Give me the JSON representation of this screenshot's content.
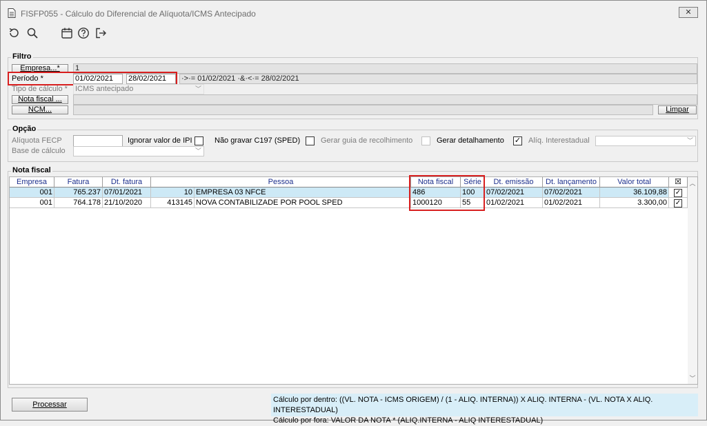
{
  "window": {
    "title": "FISFP055 - Cálculo do Diferencial de Alíquota/ICMS Antecipado",
    "close_label": "✕"
  },
  "toolbar": {
    "icons": [
      "refresh-icon",
      "search-icon",
      "calendar-icon",
      "help-icon",
      "exit-icon"
    ]
  },
  "filtro": {
    "legend": "Filtro",
    "empresa_button": "Empresa...*",
    "empresa_value": "1",
    "periodo_label": "Período *",
    "periodo_inicio": "01/02/2021",
    "periodo_fim": "28/02/2021",
    "periodo_expr": "·>·= 01/02/2021 ·&·<·= 28/02/2021",
    "tipo_calculo_label": "Tipo de cálculo *",
    "tipo_calculo_value": "ICMS antecipado",
    "nota_fiscal_button": "Nota fiscal ...",
    "ncm_button": "NCM...",
    "limpar_button": "Limpar"
  },
  "opcao": {
    "legend": "Opção",
    "aliquota_fecp_label": "Alíquota FECP",
    "ignorar_ipi_label": "Ignorar valor de IPI",
    "nao_gravar_label": "Não gravar C197 (SPED)",
    "gerar_guia_label": "Gerar guia de recolhimento",
    "gerar_detalhamento_label": "Gerar detalhamento",
    "aliq_interestadual_label": "Alíq. Interestadual",
    "base_calculo_label": "Base de cálculo",
    "check_mark": "✓"
  },
  "nota_fiscal": {
    "legend": "Nota fiscal",
    "columns": [
      "Empresa",
      "Fatura",
      "Dt. fatura",
      "Pessoa",
      "Nota fiscal",
      "Série",
      "Dt. emissão",
      "Dt. lançamento",
      "Valor total",
      "☒"
    ],
    "rows": [
      {
        "empresa": "001",
        "fatura": "765.237",
        "dt_fatura": "07/01/2021",
        "pessoa_cod": "10",
        "pessoa_nome": "EMPRESA 03 NFCE",
        "nota_fiscal": "486",
        "serie": "100",
        "dt_emissao": "07/02/2021",
        "dt_lancamento": "07/02/2021",
        "valor_total": "36.109,88",
        "checked": "✓"
      },
      {
        "empresa": "001",
        "fatura": "764.178",
        "dt_fatura": "21/10/2020",
        "pessoa_cod": "413145",
        "pessoa_nome": "NOVA CONTABILIZADE POR POOL SPED",
        "nota_fiscal": "1000120",
        "serie": "55",
        "dt_emissao": "01/02/2021",
        "dt_lancamento": "01/02/2021",
        "valor_total": "3.300,00",
        "checked": "✓"
      }
    ]
  },
  "footer": {
    "processar_button": "Processar",
    "calc_dentro": "Cálculo por dentro: ((VL. NOTA - ICMS ORIGEM) / (1 - ALIQ. INTERNA)) X ALIQ. INTERNA - (VL. NOTA X ALIQ. INTERESTADUAL)",
    "calc_fora": "Cálculo por fora: VALOR DA NOTA * (ALIQ.INTERNA - ALIQ INTERESTADUAL)"
  },
  "colors": {
    "highlight_red": "#d81e1e",
    "selected_row": "#cde9f6",
    "header_text": "#1c2f8c",
    "info_panel": "#d8eef8"
  }
}
